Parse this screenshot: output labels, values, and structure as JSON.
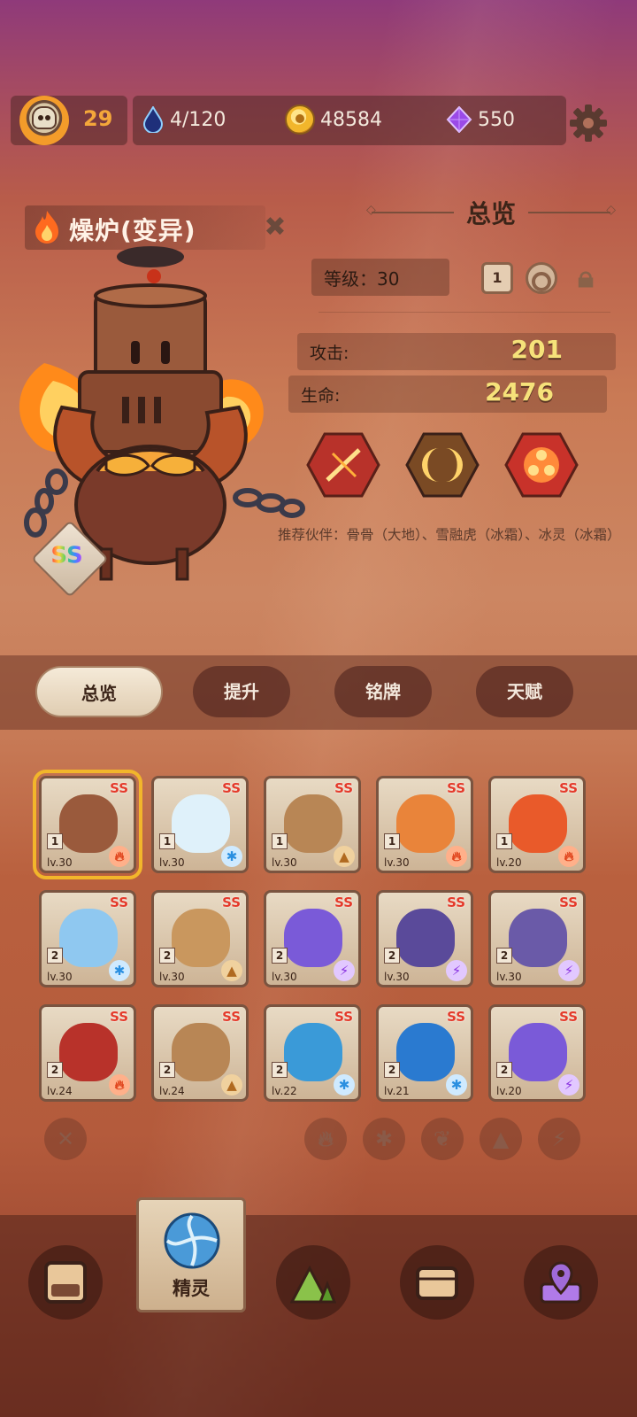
{
  "topbar": {
    "player_level": "29",
    "energy": "4/120",
    "coins": "48584",
    "gems": "550"
  },
  "hero": {
    "name": "燥炉(变异)",
    "rarity": "SS"
  },
  "overview": {
    "title": "总览",
    "level_label": "等级：30",
    "rank_value": "1",
    "attack_label": "攻击:",
    "attack_value": "201",
    "hp_label": "生命:",
    "hp_value": "2476",
    "partners_text": "推荐伙伴：骨骨（大地）、雪融虎（冰霜）、冰灵（冰霜）"
  },
  "tabs": [
    {
      "label": "总览",
      "active": true
    },
    {
      "label": "提升",
      "active": false
    },
    {
      "label": "铭牌",
      "active": false
    },
    {
      "label": "天赋",
      "active": false
    }
  ],
  "cards": [
    {
      "star": "1",
      "lv": "lv.30",
      "rarity": "SS",
      "element": "fire",
      "color": "#9a5a3c",
      "selected": true
    },
    {
      "star": "1",
      "lv": "lv.30",
      "rarity": "SS",
      "element": "ice",
      "color": "#dff1fa"
    },
    {
      "star": "1",
      "lv": "lv.30",
      "rarity": "SS",
      "element": "earth",
      "color": "#b88655"
    },
    {
      "star": "1",
      "lv": "lv.30",
      "rarity": "SS",
      "element": "fire",
      "color": "#e9843a"
    },
    {
      "star": "1",
      "lv": "lv.20",
      "rarity": "SS",
      "element": "fire",
      "color": "#e95a2a"
    },
    {
      "star": "2",
      "lv": "lv.30",
      "rarity": "SS",
      "element": "ice",
      "color": "#8fc8f0"
    },
    {
      "star": "2",
      "lv": "lv.30",
      "rarity": "SS",
      "element": "earth",
      "color": "#c9975e"
    },
    {
      "star": "2",
      "lv": "lv.30",
      "rarity": "SS",
      "element": "thunder",
      "color": "#7a5ad8"
    },
    {
      "star": "2",
      "lv": "lv.30",
      "rarity": "SS",
      "element": "thunder",
      "color": "#5a4a9a"
    },
    {
      "star": "2",
      "lv": "lv.30",
      "rarity": "SS",
      "element": "thunder",
      "color": "#6a5aa8"
    },
    {
      "star": "2",
      "lv": "lv.24",
      "rarity": "SS",
      "element": "fire",
      "color": "#b8322a"
    },
    {
      "star": "2",
      "lv": "lv.24",
      "rarity": "SS",
      "element": "earth",
      "color": "#b88655"
    },
    {
      "star": "2",
      "lv": "lv.22",
      "rarity": "SS",
      "element": "ice",
      "color": "#3a9ad8"
    },
    {
      "star": "2",
      "lv": "lv.21",
      "rarity": "SS",
      "element": "ice",
      "color": "#2a7ad0"
    },
    {
      "star": "2",
      "lv": "lv.20",
      "rarity": "SS",
      "element": "thunder",
      "color": "#7a5ad8"
    }
  ],
  "nav": {
    "active_label": "精灵"
  }
}
